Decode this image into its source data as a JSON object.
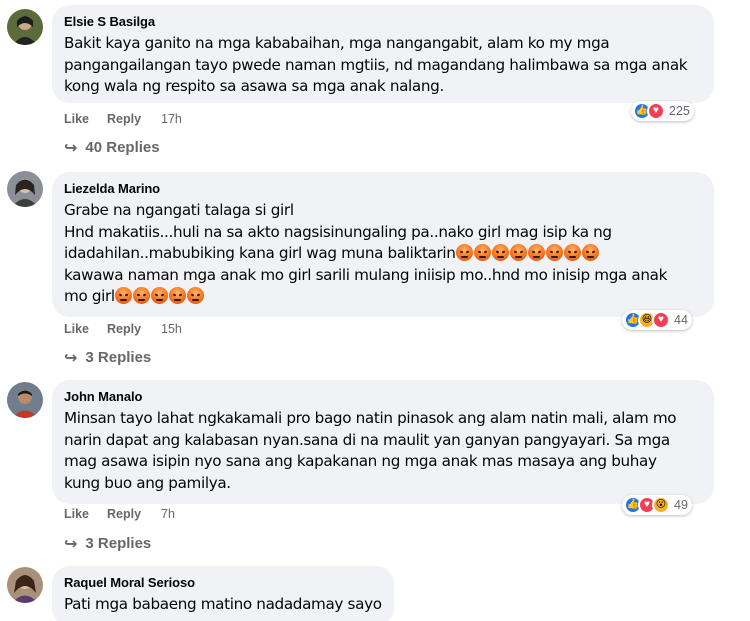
{
  "colors": {
    "bubble": "#f0f2f5",
    "meta": "#65676b",
    "like_blue": "#1877f2",
    "love_red": "#f33e58",
    "haha_yellow": "#f7b125"
  },
  "comments": [
    {
      "author": "Elsie S Basilga",
      "lines": [
        "Bakit kaya ganito na mga kababaihan, mga nangangabit, alam ko my mga",
        "pangangailangan tayo pwede naman mgtiis, nd magandang halimbawa sa mga anak",
        "kong wala ng respito sa asawa sa mga anak nalang."
      ],
      "like": "Like",
      "reply": "Reply",
      "time": "17h",
      "reactions": [
        "like",
        "love"
      ],
      "reaction_count": "225",
      "replies": "40 Replies"
    },
    {
      "author": "Liezelda Marino",
      "lines": [
        "Grabe na ngangati talaga si girl",
        "Hnd makatiis...huli na sa akto nagsisinungaling pa..nako girl mag isip ka ng",
        "idadahilan..mabubiking kana girl wag muna baliktarin",
        "kawawa naman mga anak mo girl sarili mulang iniisip mo..hnd mo inisip mga anak",
        "mo girl"
      ],
      "line3_emoji_count": 8,
      "line5_emoji_count": 5,
      "like": "Like",
      "reply": "Reply",
      "time": "15h",
      "reactions": [
        "like",
        "haha",
        "love"
      ],
      "reaction_count": "44",
      "replies": "3 Replies"
    },
    {
      "author": "John Manalo",
      "lines": [
        "Minsan tayo lahat ngkakamali pro bago natin pinasok ang alam natin mali, alam mo",
        "narin dapat ang kalabasan nyan.sana di na maulit yan ganyan pangyayari. Sa mga",
        "mag asawa isipin nyo sana ang kapakanan ng mga anak mas masaya ang buhay",
        "kung buo ang pamilya."
      ],
      "like": "Like",
      "reply": "Reply",
      "time": "7h",
      "reactions": [
        "like",
        "love",
        "wow"
      ],
      "reaction_count": "49",
      "replies": "3 Replies"
    },
    {
      "author": "Raquel Moral Serioso",
      "lines": [
        "Pati mga babaeng matino nadadamay sayo"
      ]
    }
  ]
}
